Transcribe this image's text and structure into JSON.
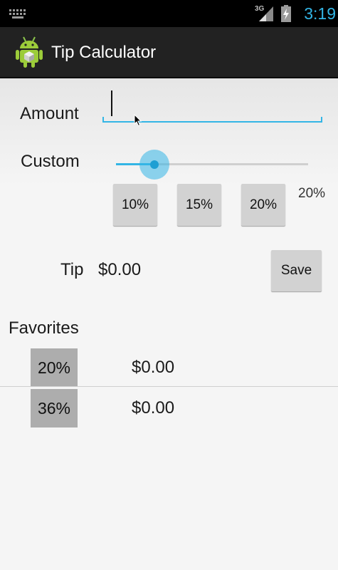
{
  "status_bar": {
    "network": "3G",
    "time": "3:19"
  },
  "app": {
    "title": "Tip Calculator"
  },
  "amount": {
    "label": "Amount",
    "value": "",
    "placeholder": ""
  },
  "custom": {
    "label": "Custom",
    "percent_label": "20%",
    "slider_value": 0.2
  },
  "presets": [
    {
      "label": "10%"
    },
    {
      "label": "15%"
    },
    {
      "label": "20%"
    }
  ],
  "tip": {
    "label": "Tip",
    "value": "$0.00"
  },
  "save_label": "Save",
  "favorites": {
    "title": "Favorites",
    "items": [
      {
        "percent": "20%",
        "amount": "$0.00"
      },
      {
        "percent": "36%",
        "amount": "$0.00"
      }
    ]
  },
  "colors": {
    "accent": "#33b5e5",
    "status_bar": "#000000",
    "action_bar": "#222222",
    "background": "#f5f5f5"
  }
}
